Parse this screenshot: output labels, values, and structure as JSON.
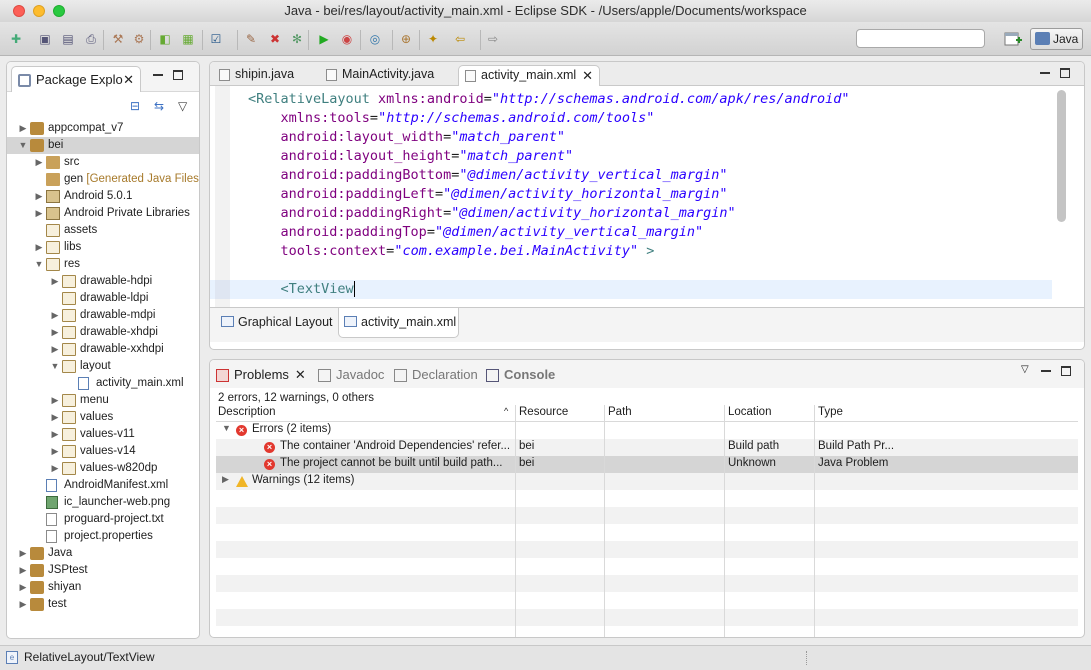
{
  "window": {
    "title": "Java - bei/res/layout/activity_main.xml - Eclipse SDK - /Users/apple/Documents/workspace"
  },
  "toolbar": {
    "search_value": "",
    "perspective_label": "Java",
    "icons": [
      "new-icon",
      "save-icon",
      "save-all-icon",
      "print-icon",
      "build-icon",
      "build-all-icon",
      "android-sdk-icon",
      "avd-manager-icon",
      "task-icon",
      "lint-icon",
      "error-icon",
      "debug-icon",
      "run-icon",
      "run-ext-icon",
      "open-type-icon",
      "new-class-icon",
      "search-icon",
      "back-icon",
      "forward-icon"
    ]
  },
  "package_explorer": {
    "tab_label": "Package Explo",
    "tree": [
      {
        "label": "appcompat_v7",
        "icon": "project",
        "indent": 0,
        "twisty": "▶"
      },
      {
        "label": "bei",
        "icon": "project",
        "indent": 0,
        "twisty": "▼",
        "selected": true
      },
      {
        "label": "src",
        "icon": "pkg",
        "indent": 1,
        "twisty": "▶"
      },
      {
        "label": "gen",
        "decoration": " [Generated Java Files]",
        "icon": "pkg",
        "indent": 1,
        "twisty": ""
      },
      {
        "label": "Android 5.0.1",
        "icon": "lib",
        "indent": 1,
        "twisty": "▶"
      },
      {
        "label": "Android Private Libraries",
        "icon": "lib",
        "indent": 1,
        "twisty": "▶"
      },
      {
        "label": "assets",
        "icon": "folder",
        "indent": 1,
        "twisty": ""
      },
      {
        "label": "libs",
        "icon": "folder",
        "indent": 1,
        "twisty": "▶"
      },
      {
        "label": "res",
        "icon": "folder",
        "indent": 1,
        "twisty": "▼"
      },
      {
        "label": "drawable-hdpi",
        "icon": "folder",
        "indent": 2,
        "twisty": "▶"
      },
      {
        "label": "drawable-ldpi",
        "icon": "folder",
        "indent": 2,
        "twisty": ""
      },
      {
        "label": "drawable-mdpi",
        "icon": "folder",
        "indent": 2,
        "twisty": "▶"
      },
      {
        "label": "drawable-xhdpi",
        "icon": "folder",
        "indent": 2,
        "twisty": "▶"
      },
      {
        "label": "drawable-xxhdpi",
        "icon": "folder",
        "indent": 2,
        "twisty": "▶"
      },
      {
        "label": "layout",
        "icon": "folder",
        "indent": 2,
        "twisty": "▼"
      },
      {
        "label": "activity_main.xml",
        "icon": "xmlfile",
        "indent": 3,
        "twisty": ""
      },
      {
        "label": "menu",
        "icon": "folder",
        "indent": 2,
        "twisty": "▶"
      },
      {
        "label": "values",
        "icon": "folder",
        "indent": 2,
        "twisty": "▶"
      },
      {
        "label": "values-v11",
        "icon": "folder",
        "indent": 2,
        "twisty": "▶"
      },
      {
        "label": "values-v14",
        "icon": "folder",
        "indent": 2,
        "twisty": "▶"
      },
      {
        "label": "values-w820dp",
        "icon": "folder",
        "indent": 2,
        "twisty": "▶"
      },
      {
        "label": "AndroidManifest.xml",
        "icon": "xmlfile",
        "indent": 1,
        "twisty": ""
      },
      {
        "label": "ic_launcher-web.png",
        "icon": "img",
        "indent": 1,
        "twisty": ""
      },
      {
        "label": "proguard-project.txt",
        "icon": "file",
        "indent": 1,
        "twisty": ""
      },
      {
        "label": "project.properties",
        "icon": "file",
        "indent": 1,
        "twisty": ""
      },
      {
        "label": "Java",
        "icon": "project",
        "indent": 0,
        "twisty": "▶"
      },
      {
        "label": "JSPtest",
        "icon": "project",
        "indent": 0,
        "twisty": "▶"
      },
      {
        "label": "shiyan",
        "icon": "project",
        "indent": 0,
        "twisty": "▶"
      },
      {
        "label": "test",
        "icon": "project",
        "indent": 0,
        "twisty": "▶"
      }
    ]
  },
  "editor": {
    "tabs": [
      {
        "label": "shipin.java",
        "active": false
      },
      {
        "label": "MainActivity.java",
        "active": false
      },
      {
        "label": "activity_main.xml",
        "active": true
      }
    ],
    "code_lines": [
      [
        [
          "tag",
          "<RelativeLayout "
        ],
        [
          "attr",
          "xmlns:android"
        ],
        [
          "plain",
          "="
        ],
        [
          "val",
          "\"http://schemas.android.com/apk/res/android\""
        ]
      ],
      [
        [
          "attr",
          "    xmlns:tools"
        ],
        [
          "plain",
          "="
        ],
        [
          "val",
          "\"http://schemas.android.com/tools\""
        ]
      ],
      [
        [
          "attr",
          "    android:layout_width"
        ],
        [
          "plain",
          "="
        ],
        [
          "val",
          "\"match_parent\""
        ]
      ],
      [
        [
          "attr",
          "    android:layout_height"
        ],
        [
          "plain",
          "="
        ],
        [
          "val",
          "\"match_parent\""
        ]
      ],
      [
        [
          "attr",
          "    android:paddingBottom"
        ],
        [
          "plain",
          "="
        ],
        [
          "val",
          "\"@dimen/activity_vertical_margin\""
        ]
      ],
      [
        [
          "attr",
          "    android:paddingLeft"
        ],
        [
          "plain",
          "="
        ],
        [
          "val",
          "\"@dimen/activity_horizontal_margin\""
        ]
      ],
      [
        [
          "attr",
          "    android:paddingRight"
        ],
        [
          "plain",
          "="
        ],
        [
          "val",
          "\"@dimen/activity_horizontal_margin\""
        ]
      ],
      [
        [
          "attr",
          "    android:paddingTop"
        ],
        [
          "plain",
          "="
        ],
        [
          "val",
          "\"@dimen/activity_vertical_margin\""
        ]
      ],
      [
        [
          "attr",
          "    tools:context"
        ],
        [
          "plain",
          "="
        ],
        [
          "val",
          "\"com.example.bei.MainActivity\""
        ],
        [
          "tag",
          " >"
        ]
      ],
      [
        [
          "plain",
          ""
        ]
      ],
      [
        [
          "tag",
          "    <TextView"
        ]
      ]
    ],
    "current_line": 11,
    "bottom_tabs": [
      {
        "label": "Graphical Layout",
        "active": false
      },
      {
        "label": "activity_main.xml",
        "active": true
      }
    ]
  },
  "problems": {
    "tabs": [
      {
        "label": "Problems",
        "active": true,
        "icon": "problems-icon"
      },
      {
        "label": "Javadoc",
        "active": false,
        "icon": "javadoc-icon"
      },
      {
        "label": "Declaration",
        "active": false,
        "icon": "declaration-icon"
      },
      {
        "label": "Console",
        "active": false,
        "icon": "console-icon"
      }
    ],
    "summary": "2 errors, 12 warnings, 0 others",
    "columns": [
      "Description",
      "Resource",
      "Path",
      "Location",
      "Type"
    ],
    "rows": [
      {
        "kind": "group-error",
        "twisty": "▼",
        "description": "Errors (2 items)",
        "resource": "",
        "path": "",
        "location": "",
        "type": ""
      },
      {
        "kind": "error",
        "twisty": "",
        "description": "The container 'Android Dependencies' refer...",
        "resource": "bei",
        "path": "",
        "location": "Build path",
        "type": "Build Path Pr..."
      },
      {
        "kind": "error",
        "twisty": "",
        "description": "The project cannot be built until build path...",
        "resource": "bei",
        "path": "",
        "location": "Unknown",
        "type": "Java Problem",
        "selected": true
      },
      {
        "kind": "group-warning",
        "twisty": "▶",
        "description": "Warnings (12 items)",
        "resource": "",
        "path": "",
        "location": "",
        "type": ""
      }
    ],
    "empty_rows": 8
  },
  "status": {
    "text": "RelativeLayout/TextView"
  }
}
